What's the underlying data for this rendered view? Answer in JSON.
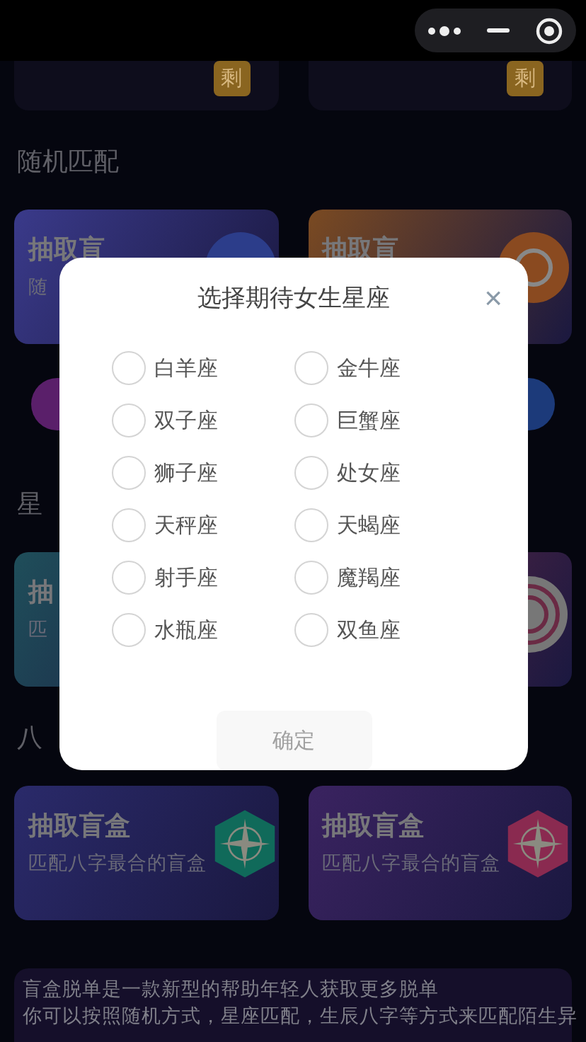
{
  "top_cards": [
    {
      "badge": "剩"
    },
    {
      "badge": "剩"
    }
  ],
  "sections": [
    {
      "title": "随机匹配",
      "kind": "cards",
      "cards": [
        {
          "title": "抽取盲",
          "subtitle": "随",
          "color": "#3a3a8a",
          "kind": "circle"
        },
        {
          "title": "抽取盲",
          "color": "#7a4a22",
          "kind": "ring"
        }
      ]
    },
    {
      "kind": "pills",
      "pills": [
        {
          "color": "#5a1f6a"
        },
        {
          "color": "#1c3a7a"
        }
      ]
    },
    {
      "title": "星",
      "kind": "cards",
      "cards": [
        {
          "title": "抽",
          "subtitle": "匹",
          "color": "#1f4e5a",
          "kind": "plain"
        },
        {
          "color": "#6a2a44",
          "kind": "swirl"
        }
      ]
    },
    {
      "title": "八",
      "kind": "cards",
      "cards": [
        {
          "title": "抽取盲盒",
          "subtitle": "匹配八字最合的盲盒",
          "color": "#2a2a6a",
          "kind": "compass-green"
        },
        {
          "title": "抽取盲盒",
          "subtitle": "匹配八字最合的盲盒",
          "color": "#3a2360",
          "kind": "compass-red"
        }
      ]
    }
  ],
  "intro": [
    "盲盒脱单是一款新型的帮助年轻人获取更多脱单",
    "你可以按照随机方式，星座匹配，生辰八字等方式来匹配陌生异"
  ],
  "dialog": {
    "title": "选择期待女生星座",
    "close": "×",
    "options": [
      {
        "label": "白羊座",
        "selected": false
      },
      {
        "label": "金牛座",
        "selected": false
      },
      {
        "label": "双子座",
        "selected": false
      },
      {
        "label": "巨蟹座",
        "selected": false
      },
      {
        "label": "狮子座",
        "selected": false
      },
      {
        "label": "处女座",
        "selected": false
      },
      {
        "label": "天秤座",
        "selected": false
      },
      {
        "label": "天蝎座",
        "selected": false
      },
      {
        "label": "射手座",
        "selected": false
      },
      {
        "label": "魔羯座",
        "selected": false
      },
      {
        "label": "水瓶座",
        "selected": false
      },
      {
        "label": "双鱼座",
        "selected": false
      }
    ],
    "confirm": {
      "label": "确定",
      "disabled": true
    }
  }
}
